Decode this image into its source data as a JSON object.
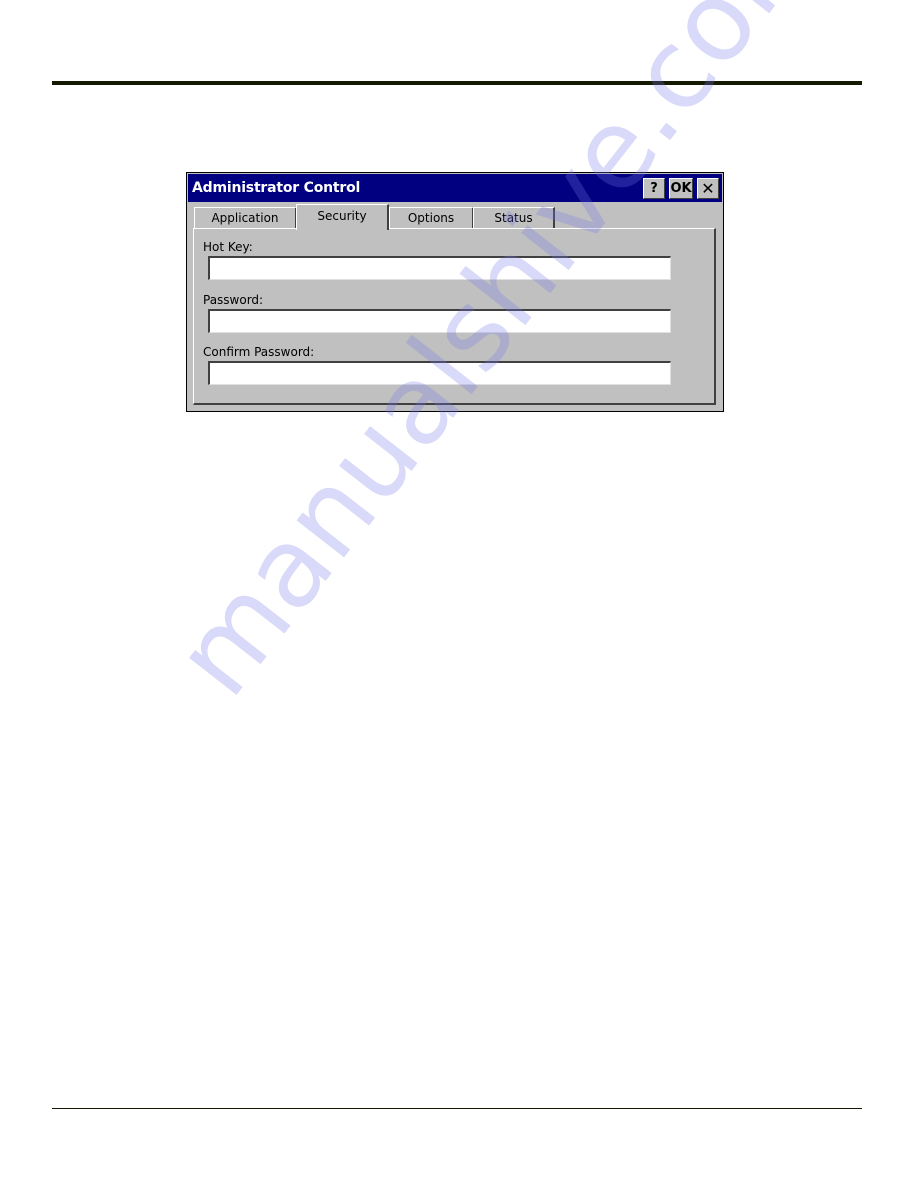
{
  "document": {
    "watermark": "manualshive.com"
  },
  "dialog": {
    "title": "Administrator Control",
    "title_buttons": {
      "help": "?",
      "ok": "OK",
      "close": "✕"
    },
    "tabs": [
      {
        "label": "Application",
        "active": false
      },
      {
        "label": "Security",
        "active": true
      },
      {
        "label": "Options",
        "active": false
      },
      {
        "label": "Status",
        "active": false
      }
    ],
    "fields": {
      "hot_key": {
        "label": "Hot Key:",
        "value": ""
      },
      "password": {
        "label": "Password:",
        "value": ""
      },
      "confirm_password": {
        "label": "Confirm Password:",
        "value": ""
      }
    },
    "colors": {
      "titlebar": "#000080",
      "face": "#c0c0c0"
    }
  }
}
